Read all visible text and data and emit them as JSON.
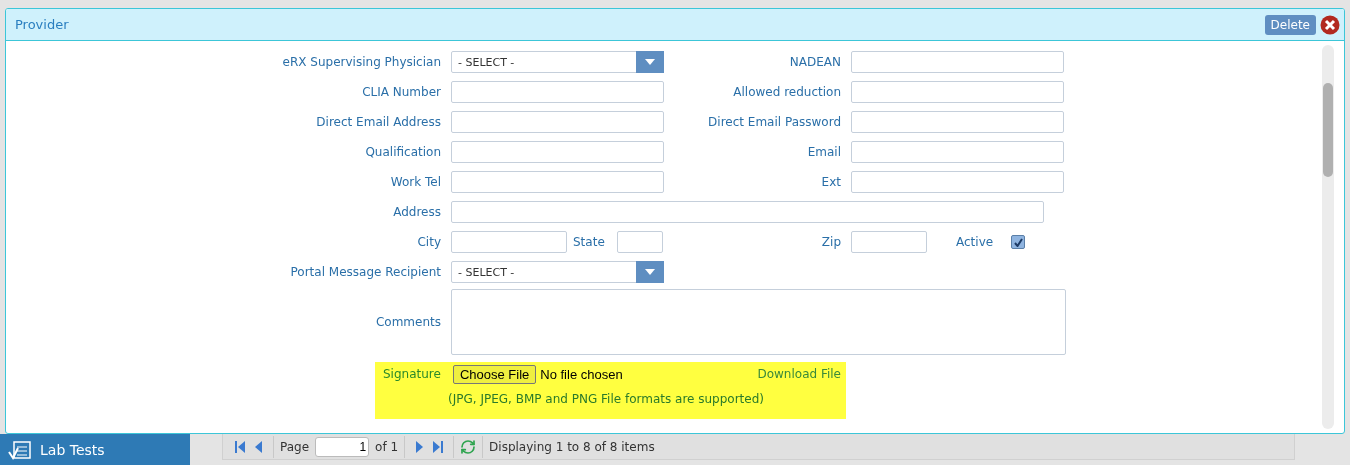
{
  "dialog": {
    "title": "Provider",
    "delete_button": "Delete"
  },
  "form": {
    "rows": [
      {
        "kind": "pair",
        "fields": [
          {
            "label": "eRX Supervising Physician",
            "kind": "select",
            "value": "- SELECT -"
          },
          {
            "label": "NADEAN",
            "kind": "text"
          }
        ]
      },
      {
        "kind": "pair",
        "fields": [
          {
            "label": "CLIA Number",
            "kind": "text"
          },
          {
            "label": "Allowed reduction",
            "kind": "text"
          }
        ]
      },
      {
        "kind": "pair",
        "fields": [
          {
            "label": "Direct Email Address",
            "kind": "text"
          },
          {
            "label": "Direct Email Password",
            "kind": "text"
          }
        ]
      },
      {
        "kind": "pair",
        "fields": [
          {
            "label": "Qualification",
            "kind": "text"
          },
          {
            "label": "Email",
            "kind": "text"
          }
        ]
      },
      {
        "kind": "pair",
        "fields": [
          {
            "label": "Work Tel",
            "kind": "text"
          },
          {
            "label": "Ext",
            "kind": "text"
          }
        ]
      },
      {
        "kind": "wide",
        "fields": [
          {
            "label": "Address",
            "kind": "text"
          }
        ]
      },
      {
        "kind": "city",
        "fields": [
          {
            "label": "City",
            "kind": "text"
          },
          {
            "label": "State",
            "kind": "text"
          },
          {
            "label": "Zip",
            "kind": "text"
          },
          {
            "label": "Active",
            "kind": "checkbox",
            "checked": true
          }
        ]
      },
      {
        "kind": "pair",
        "fields": [
          {
            "label": "Portal Message Recipient",
            "kind": "select",
            "value": "- SELECT -"
          }
        ]
      },
      {
        "kind": "textarea",
        "fields": [
          {
            "label": "Comments",
            "kind": "textarea"
          }
        ]
      }
    ]
  },
  "signature": {
    "label": "Signature",
    "button": "Choose File",
    "status": "No file chosen",
    "link": "Download File",
    "note": "(JPG, JPEG, BMP and PNG File formats are supported)"
  },
  "sidebar": {
    "items": [
      {
        "label": "Lab Tests"
      }
    ]
  },
  "pager": {
    "page_label": "Page",
    "page": "1",
    "of": "of 1",
    "status": "Displaying 1 to 8 of 8 items"
  }
}
